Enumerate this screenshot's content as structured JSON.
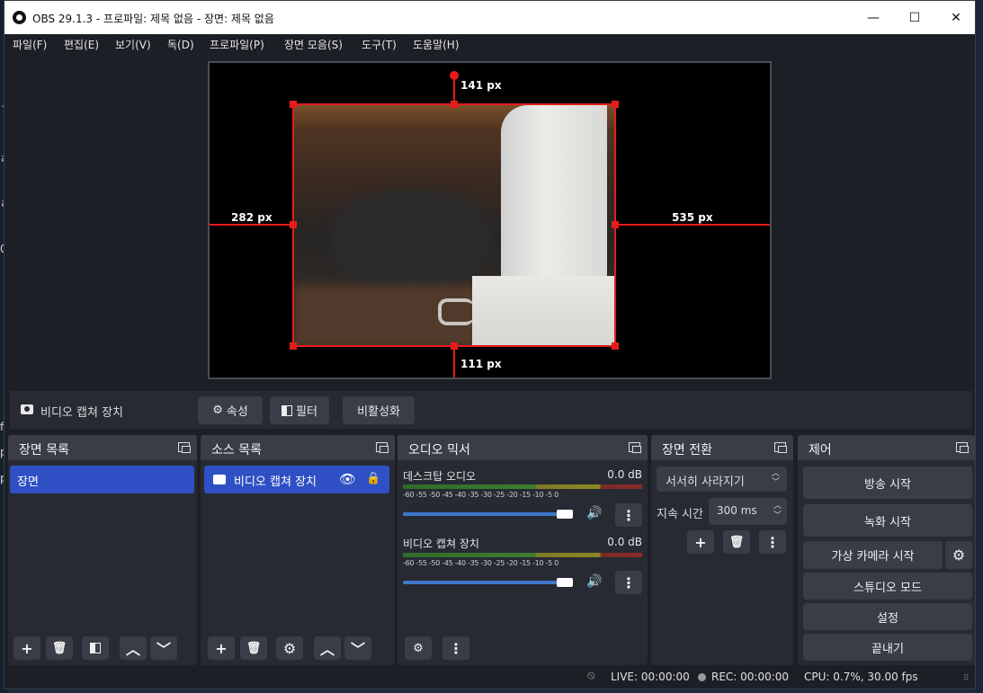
{
  "window": {
    "title": "OBS 29.1.3 - 프로파일: 제목 없음 - 장면: 제목 없음",
    "minimize": "—",
    "maximize": "☐",
    "close": "✕"
  },
  "menu": [
    "파일(F)",
    "편집(E)",
    "보기(V)",
    "독(D)",
    "프로파일(P)",
    "장면 모음(S)",
    "도구(T)",
    "도움말(H)"
  ],
  "preview": {
    "top_label": "141 px",
    "left_label": "282 px",
    "right_label": "535 px",
    "bottom_label": "111 px"
  },
  "source_toolbar": {
    "source_name": "비디오 캡쳐 장치",
    "properties": "속성",
    "filters": "필터",
    "deactivate": "비활성화"
  },
  "docks": {
    "scenes": {
      "title": "장면 목록",
      "items": [
        "장면"
      ]
    },
    "sources": {
      "title": "소스 목록",
      "items": [
        "비디오 캡쳐 장치"
      ]
    },
    "mixer": {
      "title": "오디오 믹서",
      "ticks": "-60 -55 -50 -45 -40 -35 -30 -25 -20 -15 -10 -5 0",
      "channels": [
        {
          "name": "데스크탑 오디오",
          "level": "0.0 dB",
          "volume": 0.97
        },
        {
          "name": "비디오 캡쳐 장치",
          "level": "0.0 dB",
          "volume": 0.97
        }
      ]
    },
    "transitions": {
      "title": "장면 전환",
      "selected": "서서히 사라지기",
      "duration_label": "지속 시간",
      "duration_value": "300 ms"
    },
    "controls": {
      "title": "제어",
      "start_streaming": "방송 시작",
      "start_recording": "녹화 시작",
      "start_virtualcam": "가상 카메라 시작",
      "studio_mode": "스튜디오 모드",
      "settings": "설정",
      "exit": "끝내기"
    }
  },
  "status": {
    "live": "LIVE: 00:00:00",
    "rec": "REC: 00:00:00",
    "cpu": "CPU: 0.7%, 30.00 fps"
  },
  "colors": {
    "accent": "#2f50c4",
    "bounds": "#e61c1c",
    "dock": "#272a33",
    "button": "#3a3d48"
  }
}
